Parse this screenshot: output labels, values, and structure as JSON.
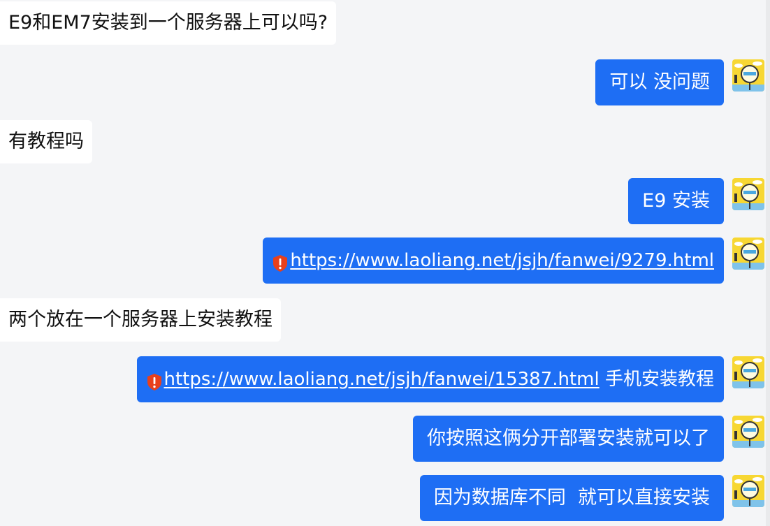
{
  "messages": [
    {
      "side": "in",
      "text": "E9和EM7安装到一个服务器上可以吗?"
    },
    {
      "side": "out",
      "text": "可以 没问题"
    },
    {
      "side": "in",
      "text": "有教程吗"
    },
    {
      "side": "out",
      "text": "E9 安装"
    },
    {
      "side": "out",
      "link": "https://www.laoliang.net/jsjh/fanwei/9279.html"
    },
    {
      "side": "in",
      "text": "两个放在一个服务器上安装教程"
    },
    {
      "side": "out",
      "link": "https://www.laoliang.net/jsjh/fanwei/15387.html",
      "suffix": " 手机安装教程"
    },
    {
      "side": "out",
      "text": "你按照这俩分开部署安装就可以了"
    },
    {
      "side": "out",
      "text": "因为数据库不同  就可以直接安装"
    }
  ],
  "icons": {
    "link_warning": "shield-warning-icon",
    "avatar": "cartoon-avatar-icon"
  },
  "colors": {
    "background": "#f4f5f7",
    "incoming_bubble": "#ffffff",
    "outgoing_bubble": "#1e6ef4",
    "warning_shield": "#e8401c"
  }
}
